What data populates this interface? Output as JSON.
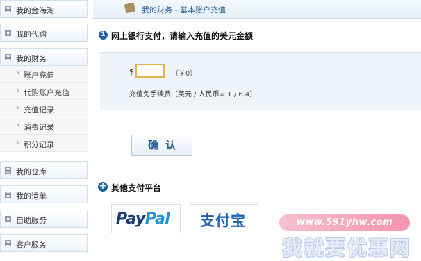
{
  "sidebar": {
    "sections": [
      {
        "label": "我的金海淘",
        "toggle": "⊞"
      },
      {
        "label": "我的代购",
        "toggle": "⊞"
      },
      {
        "label": "我的财务",
        "toggle": "⊟"
      },
      {
        "label": "我的仓库",
        "toggle": "⊞"
      },
      {
        "label": "我的运单",
        "toggle": "⊞"
      },
      {
        "label": "自助服务",
        "toggle": "⊞"
      },
      {
        "label": "客户服务",
        "toggle": "⊞"
      }
    ],
    "finance_items": [
      {
        "label": "账户充值"
      },
      {
        "label": "代购账户充值"
      },
      {
        "label": "充值记录"
      },
      {
        "label": "消费记录"
      },
      {
        "label": "积分记录"
      }
    ]
  },
  "breadcrumb": {
    "text": "我的财务 - 基本账户充值",
    "icon": "document-icon"
  },
  "step1": {
    "number": "1",
    "heading": "网上银行支付，请输入充值的美元金额",
    "currency_symbol": "$",
    "amount_value": "",
    "rmb_hint": "（￥0）",
    "fee_note": "充值免手续费（美元 / 人民币= 1 / 6.4）"
  },
  "confirm_label": "确认",
  "other": {
    "heading": "其他支付平台",
    "icon": "plus-icon",
    "paypal": {
      "part1": "Pay",
      "part2": "Pal"
    },
    "alipay": {
      "text": "支付宝"
    }
  },
  "watermark": {
    "url": "www.591yhw.com",
    "text": "我就要优惠网"
  },
  "colors": {
    "accent": "#1f5fa8",
    "link": "#2a5e96",
    "input_border": "#e4b44a",
    "panel_bg": "#eef4fa"
  }
}
